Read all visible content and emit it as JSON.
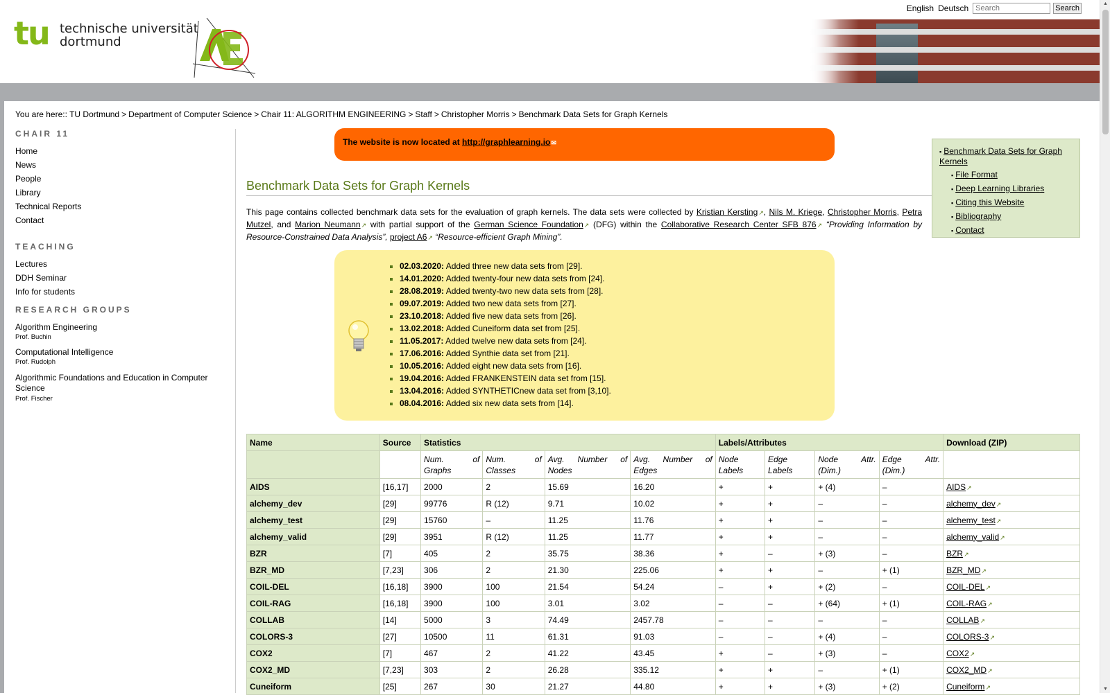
{
  "header": {
    "logo_mark": "tu",
    "logo_line1": "technische universität",
    "logo_line2": "dortmund",
    "lang_english": "English",
    "lang_deutsch": "Deutsch",
    "search_placeholder": "Search",
    "search_button": "Search"
  },
  "breadcrumb": {
    "prefix": "You are here::",
    "items": [
      "TU Dortmund",
      "Department of Computer Science",
      "Chair 11: ALGORITHM ENGINEERING",
      "Staff",
      "Christopher Morris",
      "Benchmark Data Sets for Graph Kernels"
    ],
    "separator": ">"
  },
  "sidebar": {
    "chair_heading": "Chair 11",
    "chair_items": [
      "Home",
      "News",
      "People",
      "Library",
      "Technical Reports",
      "Contact"
    ],
    "teaching_heading": "Teaching",
    "teaching_items": [
      "Lectures",
      "DDH Seminar",
      "Info for students"
    ],
    "research_heading": "Research Groups",
    "research_groups": [
      {
        "name": "Algorithm Engineering",
        "prof": "Prof. Buchin"
      },
      {
        "name": "Computational Intelligence",
        "prof": "Prof. Rudolph"
      },
      {
        "name": "Algorithmic Foundations and Education in Computer Science",
        "prof": "Prof. Fischer"
      }
    ]
  },
  "banner": {
    "text": "The website is now located at",
    "link": "http://graphlearning.io"
  },
  "main": {
    "title": "Benchmark Data Sets for Graph Kernels",
    "intro": {
      "p1": "This page contains collected benchmark data sets for the evaluation of graph kernels. The data sets were collected by",
      "kersting": "Kristian Kersting",
      "kriege": "Nils M. Kriege",
      "morris": "Christopher Morris",
      "mutzel": "Petra Mutzel",
      "and": ", and",
      "neumann": "Marion Neumann",
      "p2": "with partial support of the",
      "dfg": "German Science Foundation",
      "p3": "(DFG) within the",
      "crc": "Collaborative Research Center SFB 876",
      "crc_title": "“Providing Information by Resource-Constrained Data Analysis”,",
      "project": "project A6",
      "project_title": "“Resource-efficient Graph Mining”."
    }
  },
  "toc": {
    "main": "Benchmark Data Sets for Graph Kernels",
    "items": [
      "File Format",
      "Deep Learning Libraries",
      "Citing this Website",
      "Bibliography",
      "Contact"
    ]
  },
  "news": [
    {
      "date": "02.03.2020:",
      "text": "Added three new data sets from [29]."
    },
    {
      "date": "14.01.2020:",
      "text": "Added twenty-four new data sets from [24]."
    },
    {
      "date": "28.08.2019:",
      "text": "Added twenty-two new data sets from [28]."
    },
    {
      "date": "09.07.2019:",
      "text": "Added two new data sets from [27]."
    },
    {
      "date": "23.10.2018:",
      "text": "Added five new data sets from [26]."
    },
    {
      "date": "13.02.2018:",
      "text": "Added Cuneiform data set from [25]."
    },
    {
      "date": "11.05.2017:",
      "text": "Added twelve new data sets from [24]."
    },
    {
      "date": "17.06.2016:",
      "text": "Added Synthie data set from [21]."
    },
    {
      "date": "10.05.2016:",
      "text": "Added eight new data sets from [16]."
    },
    {
      "date": "19.04.2016:",
      "text": "Added FRANKENSTEIN data set from [15]."
    },
    {
      "date": "13.04.2016:",
      "text": "Added SYNTHETICnew data set from [3,10]."
    },
    {
      "date": "08.04.2016:",
      "text": "Added six new data sets from [14]."
    }
  ],
  "table": {
    "groups": [
      "Name",
      "Source",
      "Statistics",
      "Labels/Attributes",
      "Download (ZIP)"
    ],
    "sub": [
      "Num. of Graphs",
      "Num. of Classes",
      "Avg. Number of Nodes",
      "Avg. Number of Edges",
      "Node Labels",
      "Edge Labels",
      "Node Attr. (Dim.)",
      "Edge Attr. (Dim.)"
    ],
    "rows": [
      [
        "AIDS",
        "[16,17]",
        "2000",
        "2",
        "15.69",
        "16.20",
        "+",
        "+",
        "+ (4)",
        "–",
        "AIDS"
      ],
      [
        "alchemy_dev",
        "[29]",
        "99776",
        "R (12)",
        "9.71",
        "10.02",
        "+",
        "+",
        "–",
        "–",
        "alchemy_dev"
      ],
      [
        "alchemy_test",
        "[29]",
        "15760",
        "–",
        "11.25",
        "11.76",
        "+",
        "+",
        "–",
        "–",
        "alchemy_test"
      ],
      [
        "alchemy_valid",
        "[29]",
        "3951",
        "R (12)",
        "11.25",
        "11.77",
        "+",
        "+",
        "–",
        "–",
        "alchemy_valid"
      ],
      [
        "BZR",
        "[7]",
        "405",
        "2",
        "35.75",
        "38.36",
        "+",
        "–",
        "+ (3)",
        "–",
        "BZR"
      ],
      [
        "BZR_MD",
        "[7,23]",
        "306",
        "2",
        "21.30",
        "225.06",
        "+",
        "+",
        "–",
        "+ (1)",
        "BZR_MD"
      ],
      [
        "COIL-DEL",
        "[16,18]",
        "3900",
        "100",
        "21.54",
        "54.24",
        "–",
        "+",
        "+ (2)",
        "–",
        "COIL-DEL"
      ],
      [
        "COIL-RAG",
        "[16,18]",
        "3900",
        "100",
        "3.01",
        "3.02",
        "–",
        "–",
        "+ (64)",
        "+ (1)",
        "COIL-RAG"
      ],
      [
        "COLLAB",
        "[14]",
        "5000",
        "3",
        "74.49",
        "2457.78",
        "–",
        "–",
        "–",
        "–",
        "COLLAB"
      ],
      [
        "COLORS-3",
        "[27]",
        "10500",
        "11",
        "61.31",
        "91.03",
        "–",
        "–",
        "+ (4)",
        "–",
        "COLORS-3"
      ],
      [
        "COX2",
        "[7]",
        "467",
        "2",
        "41.22",
        "43.45",
        "+",
        "–",
        "+ (3)",
        "–",
        "COX2"
      ],
      [
        "COX2_MD",
        "[7,23]",
        "303",
        "2",
        "26.28",
        "335.12",
        "+",
        "+",
        "–",
        "+ (1)",
        "COX2_MD"
      ],
      [
        "Cuneiform",
        "[25]",
        "267",
        "30",
        "21.27",
        "44.80",
        "+",
        "+",
        "+ (3)",
        "+ (2)",
        "Cuneiform"
      ]
    ]
  },
  "colors": {
    "accent_green": "#5a7a1a",
    "banner_orange": "#ff6600",
    "news_yellow": "#fdf19e",
    "table_green": "#dde9c9"
  }
}
